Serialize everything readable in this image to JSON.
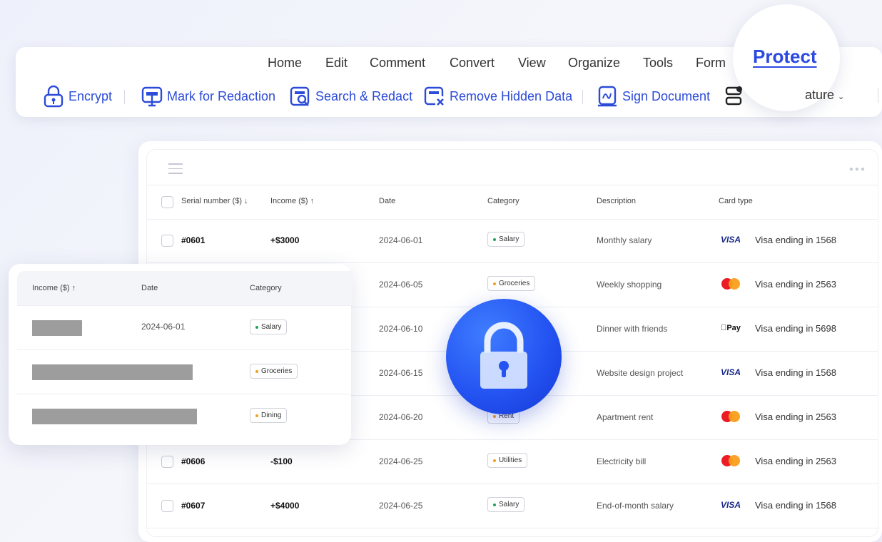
{
  "menu": [
    "Home",
    "Edit",
    "Comment",
    "Convert",
    "View",
    "Organize",
    "Tools",
    "Form",
    "Protect"
  ],
  "active_menu": "Protect",
  "toolbar": {
    "encrypt": "Encrypt",
    "mark_redaction": "Mark for Redaction",
    "search_redact": "Search & Redact",
    "remove_hidden": "Remove Hidden Data",
    "sign_document": "Sign Document",
    "signature_partial": "ature"
  },
  "table": {
    "headers": {
      "serial": "Serial number ($)",
      "income": "Income ($)",
      "date": "Date",
      "category": "Category",
      "description": "Description",
      "card_type": "Card type"
    },
    "rows": [
      {
        "serial": "#0601",
        "income": "+$3000",
        "date": "2024-06-01",
        "category": "Salary",
        "cat_color": "#21a35a",
        "description": "Monthly salary",
        "card": "visa",
        "card_text": "Visa ending in 1568"
      },
      {
        "serial": "",
        "income": "",
        "date": "2024-06-05",
        "category": "Groceries",
        "cat_color": "#f0a020",
        "description": "Weekly shopping",
        "card": "mastercard",
        "card_text": "Visa ending in 2563"
      },
      {
        "serial": "",
        "income": "",
        "date": "2024-06-10",
        "category": "",
        "cat_color": "",
        "description": "Dinner with friends",
        "card": "applepay",
        "card_text": "Visa ending in 5698"
      },
      {
        "serial": "",
        "income": "",
        "date": "2024-06-15",
        "category": "",
        "cat_color": "",
        "description": "Website design project",
        "card": "visa",
        "card_text": "Visa ending in 1568"
      },
      {
        "serial": "",
        "income": "",
        "date": "2024-06-20",
        "category": "Rent",
        "cat_color": "#f0a020",
        "description": "Apartment rent",
        "card": "mastercard",
        "card_text": "Visa ending in 2563"
      },
      {
        "serial": "#0606",
        "income": "-$100",
        "date": "2024-06-25",
        "category": "Utilities",
        "cat_color": "#f0a020",
        "description": "Electricity bill",
        "card": "mastercard",
        "card_text": "Visa ending in 2563"
      },
      {
        "serial": "#0607",
        "income": "+$4000",
        "date": "2024-06-25",
        "category": "Salary",
        "cat_color": "#21a35a",
        "description": "End-of-month salary",
        "card": "visa",
        "card_text": "Visa ending in 1568"
      }
    ]
  },
  "card_logos": {
    "visa": "VISA",
    "applepay": "Pay"
  },
  "redacted_panel": {
    "headers": {
      "income": "Income ($)",
      "date": "Date",
      "category": "Category"
    },
    "rows": [
      {
        "date": "2024-06-01",
        "category": "Salary",
        "cat_color": "#21a35a"
      },
      {
        "date": "",
        "category": "Groceries",
        "cat_color": "#f0a020"
      },
      {
        "date": "",
        "category": "Dining",
        "cat_color": "#f0a020"
      }
    ]
  },
  "colors": {
    "accent": "#2b49e0",
    "redaction": "#9d9d9d",
    "green": "#21a35a",
    "orange": "#f0a020"
  }
}
